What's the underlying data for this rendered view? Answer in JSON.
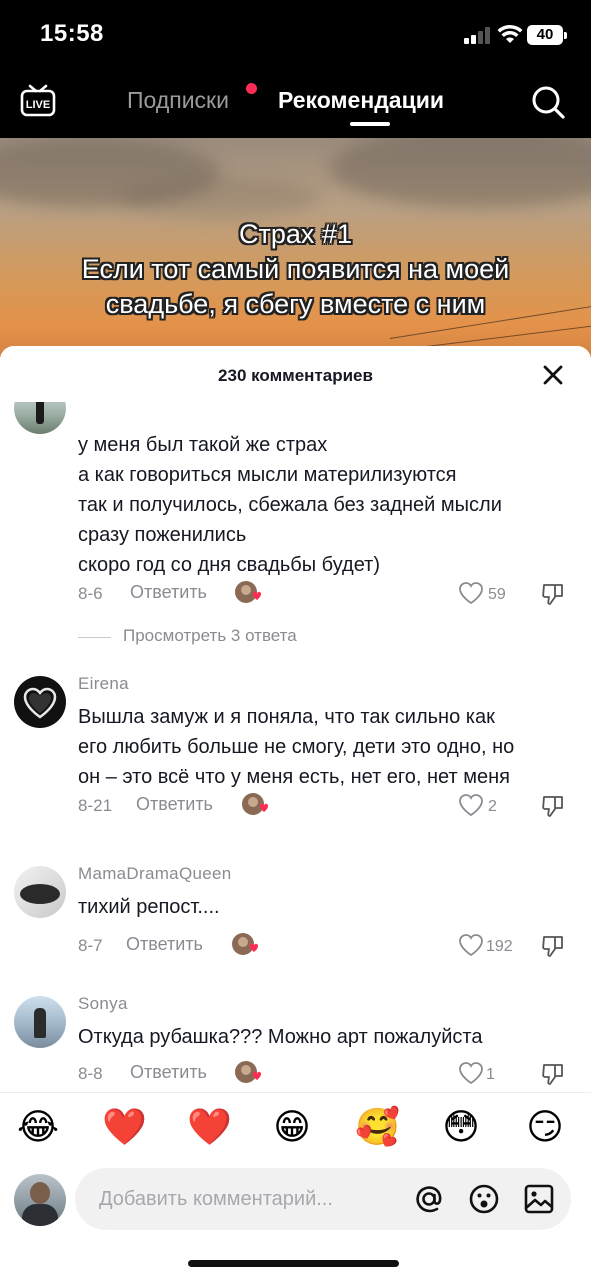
{
  "status_bar": {
    "time": "15:58",
    "battery": "40"
  },
  "nav": {
    "live_icon": "live-tv-icon",
    "tabs": [
      {
        "label": "Подписки",
        "active": false,
        "has_dot": true
      },
      {
        "label": "Рекомендации",
        "active": true
      }
    ],
    "search_icon": "search-icon"
  },
  "video": {
    "overlay_lines": [
      "Страх #1",
      "Если тот самый появится на моей",
      "свадьбе, я сбегу вместе с ним"
    ]
  },
  "comments_sheet": {
    "title": "230 комментариев",
    "close_icon": "close-icon",
    "comments": [
      {
        "username": "",
        "text_lines": [
          "у меня был такой же страх",
          "а как говориться мысли материлизуются",
          "так и получилось, сбежала без задней мысли",
          "сразу поженились",
          "скоро год со дня свадьбы будет)"
        ],
        "date": "8-6",
        "reply_label": "Ответить",
        "likes": "59",
        "view_replies": "Просмотреть 3 ответа"
      },
      {
        "username": "Eirena",
        "text_lines": [
          "Вышла замуж и я поняла, что так сильно как",
          "его любить больше не смогу, дети это одно, но",
          "он – это всё что у меня есть, нет его, нет меня"
        ],
        "date": "8-21",
        "reply_label": "Ответить",
        "likes": "2"
      },
      {
        "username": "MamaDramaQueen",
        "text_lines": [
          "тихий репост...."
        ],
        "date": "8-7",
        "reply_label": "Ответить",
        "likes": "192"
      },
      {
        "username": "Sonya",
        "text_lines": [
          "Откуда рубашка??? Можно арт пожалуйста"
        ],
        "date": "8-8",
        "reply_label": "Ответить",
        "likes": "1"
      }
    ]
  },
  "emoji_bar": [
    "😂",
    "❤️",
    "❤️",
    "😁",
    "🥰",
    "😳",
    "😏"
  ],
  "input": {
    "placeholder": "Добавить комментарий...",
    "icons": [
      "at-icon",
      "emoji-icon",
      "image-icon"
    ]
  },
  "colors": {
    "accent_red": "#ff2d55",
    "text_primary": "#161823",
    "text_secondary": "#8a8b91"
  }
}
